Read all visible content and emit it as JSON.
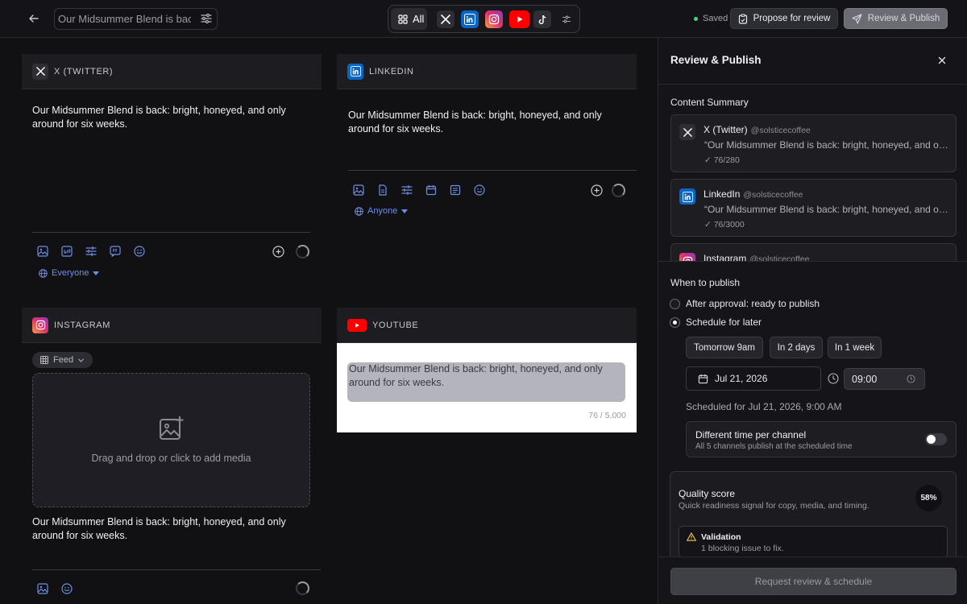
{
  "header": {
    "title_value": "Our Midsummer Blend is back: bright, honeyed, and only around for six weeks.",
    "channel_filter": {
      "all_label": "All"
    },
    "saved_label": "Saved",
    "propose_label": "Propose for review",
    "review_publish_label": "Review & Publish"
  },
  "editors": {
    "twitter": {
      "label": "X (TWITTER)",
      "text": "Our Midsummer Blend is back: bright, honeyed, and only around for six weeks.",
      "audience": "Everyone"
    },
    "linkedin": {
      "label": "LINKEDIN",
      "text": "Our Midsummer Blend is back: bright, honeyed, and only around for six weeks.",
      "audience": "Anyone"
    },
    "instagram": {
      "label": "INSTAGRAM",
      "format": "Feed",
      "dropzone": "Drag and drop or click to add media",
      "text": "Our Midsummer Blend is back: bright, honeyed, and only around for six weeks."
    },
    "youtube": {
      "label": "YOUTUBE",
      "text": "Our Midsummer Blend is back: bright, honeyed, and only around for six weeks.",
      "count": "76 / 5,000"
    }
  },
  "panel": {
    "title": "Review & Publish",
    "summary_title": "Content Summary",
    "summary": [
      {
        "name": "X (Twitter)",
        "handle": "@solsticecoffee",
        "excerpt": "“Our Midsummer Blend is back: bright, honeyed, and only around for six weeks.”",
        "count": "76/280"
      },
      {
        "name": "LinkedIn",
        "handle": "@solsticecoffee",
        "excerpt": "“Our Midsummer Blend is back: bright, honeyed, and only around for six weeks.”",
        "count": "76/3000"
      },
      {
        "name": "Instagram",
        "handle": "@solsticecoffee"
      }
    ],
    "when_title": "When to publish",
    "option_after": "After approval: ready to publish",
    "option_schedule": "Schedule for later",
    "quick": [
      "Tomorrow 9am",
      "In 2 days",
      "In 1 week"
    ],
    "date": "Jul 21, 2026",
    "time": "09:00",
    "scheduled_text": "Scheduled for Jul 21, 2026, 9:00 AM",
    "diff_title": "Different time per channel",
    "diff_sub": "All 5 channels publish at the scheduled time",
    "quality_title": "Quality score",
    "quality_sub": "Quick readiness signal for copy, media, and timing.",
    "quality_score": "58%",
    "validation_title": "Validation",
    "validation_sub": "1 blocking issue to fix.",
    "request_label": "Request review & schedule"
  },
  "colors": {
    "linkedin": "#0a66c2",
    "youtube": "#ff0000",
    "accent_blue": "#6f8fe6",
    "saved_dot": "#3ddc84"
  }
}
